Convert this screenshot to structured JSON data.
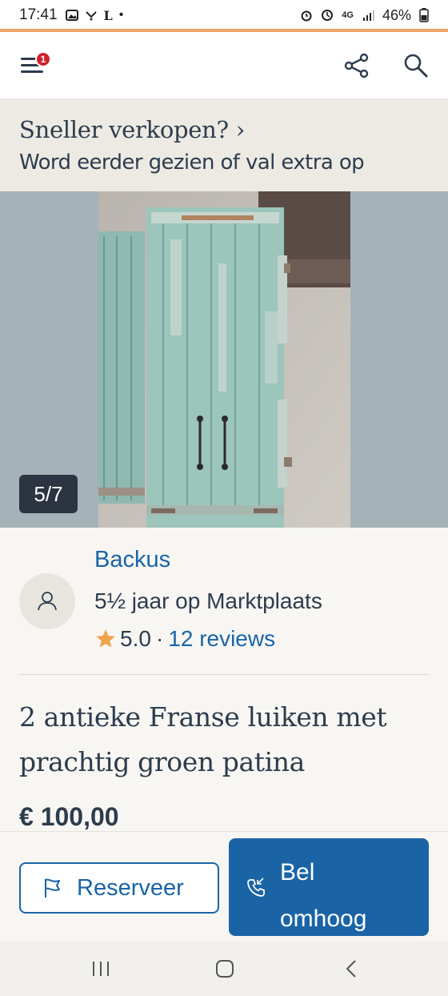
{
  "status_bar": {
    "time": "17:41",
    "network": "4G",
    "battery": "46%"
  },
  "header": {
    "menu_badge": "1",
    "icons": [
      "menu-icon",
      "share-icon",
      "search-icon"
    ]
  },
  "promo": {
    "title": "Sneller verkopen?",
    "chevron": "›",
    "subtitle": "Word eerder gezien of val extra op"
  },
  "gallery": {
    "counter": "5/7"
  },
  "seller": {
    "name": "Backus",
    "since": "5½ jaar op Marktplaats",
    "rating": "5.0",
    "separator": "·",
    "reviews": "12 reviews"
  },
  "listing": {
    "title": "2 antieke Franse luiken met prachtig groen patina",
    "price": "€ 100,00"
  },
  "actions": {
    "reserve_label": "Reserveer",
    "call_label": "Bel omhoog"
  },
  "colors": {
    "brand_blue": "#1a64a6",
    "accent_orange": "#eda566",
    "badge_red": "#d1202c",
    "star": "#f0a34c"
  }
}
